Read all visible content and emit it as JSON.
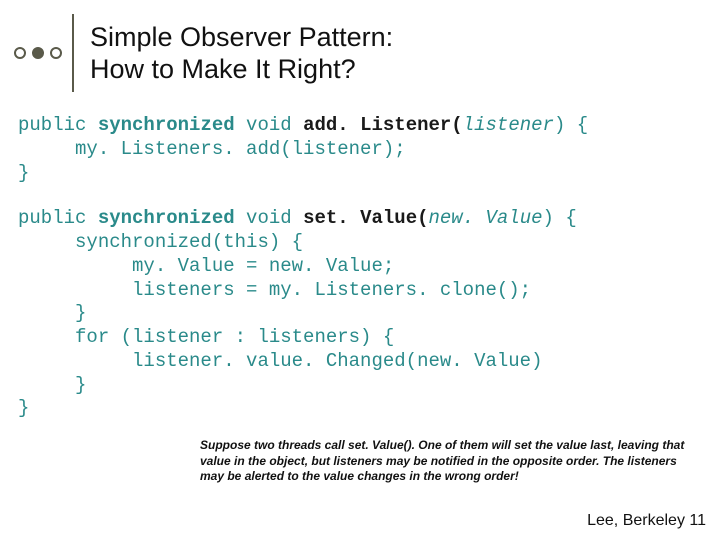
{
  "title_line1": "Simple Observer Pattern:",
  "title_line2": "How to Make It Right?",
  "code1": {
    "p": "public ",
    "sync": "synchronized",
    "void": " void ",
    "fn": "add. Listener(",
    "arg": "listener",
    "close": ") {",
    "body": "     my. Listeners. add(listener);",
    "end": "}"
  },
  "code2": {
    "p": "public ",
    "sync": "synchronized",
    "void": " void ",
    "fn": "set. Value(",
    "arg": "new. Value",
    "close": ") {",
    "l1": "     synchronized(this) {",
    "l2": "          my. Value = new. Value;",
    "l3": "          listeners = my. Listeners. clone();",
    "l4": "     }",
    "l5": "     for (listener : listeners) {",
    "l6": "          listener. value. Changed(new. Value)",
    "l7": "     }",
    "end": "}"
  },
  "note": "Suppose two threads call set. Value(). One of them will set the value last, leaving that value in the object, but listeners may be notified in the opposite order. The listeners may be alerted to the value changes in the wrong order!",
  "footer": "Lee, Berkeley 11"
}
